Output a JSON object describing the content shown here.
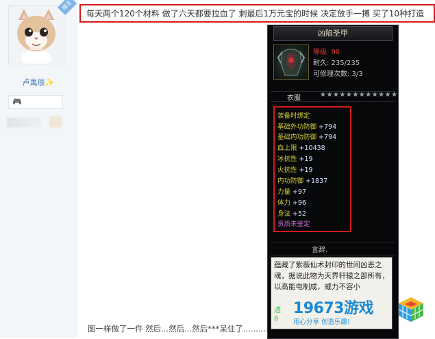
{
  "sidebar": {
    "op_badge": "楼主",
    "username": "卢禹辰✨",
    "game_chip": "🎮"
  },
  "post": {
    "text": "每天两个120个材料 做了六天都要拉血了 剩最后1万元宝的时候 决定放手一搏 买了10种打造",
    "footer": "图一样做了一件 然后...然后...然后***呆住了.........."
  },
  "tooltip": {
    "item_name": "凶陷圣甲",
    "level": "等级: 98",
    "durability": "耐久: 235/235",
    "repairs": "可修理次数: 3/3",
    "slot": "衣服",
    "stars": "★★★★★★★★★★★★",
    "bind": "装备时绑定",
    "attributes": [
      {
        "name": "基础外功防御",
        "value": "+794"
      },
      {
        "name": "基础内功防御",
        "value": "+794"
      },
      {
        "name": "血上限",
        "value": "+10438"
      },
      {
        "name": "冰抗性",
        "value": "+19"
      },
      {
        "name": "火抗性",
        "value": "+19"
      },
      {
        "name": "内功防御",
        "value": "+1837"
      },
      {
        "name": "力量",
        "value": "+97"
      },
      {
        "name": "体力",
        "value": "+96"
      },
      {
        "name": "身法",
        "value": "+52"
      }
    ],
    "quality": "资质未鉴定",
    "lore_title": "言辞.",
    "lore": "蕴藏了紫薇仙术封印的世间凶恶之魂，据说此物为天界轩辕之部所有，以高能电制成，威力不容小",
    "lore_green_1": "透",
    "lore_green_2": "8"
  },
  "watermark": {
    "number": "19673游戏",
    "slogan": "用心分享 创造乐趣!"
  }
}
